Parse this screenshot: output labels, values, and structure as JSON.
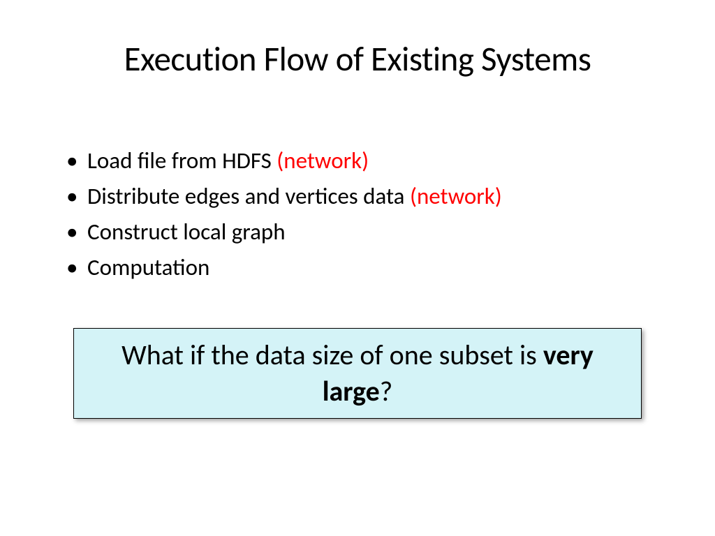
{
  "slide": {
    "title": "Execution Flow of Existing Systems",
    "bullets": [
      {
        "text": "Load file from HDFS ",
        "annotation": "(network)"
      },
      {
        "text": "Distribute edges and vertices data ",
        "annotation": "(network)"
      },
      {
        "text": "Construct local graph",
        "annotation": ""
      },
      {
        "text": "Computation",
        "annotation": ""
      }
    ],
    "callout": {
      "prefix": "What if the data size of one subset is ",
      "emphasis": "very large",
      "suffix": "?"
    }
  }
}
